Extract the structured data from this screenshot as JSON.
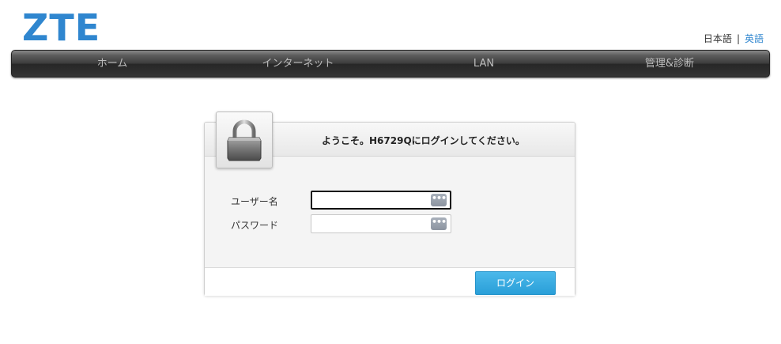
{
  "brand": {
    "logo_text": "ZTE",
    "accent_color": "#2f86cf"
  },
  "language": {
    "current": "日本語",
    "separator": "|",
    "other": "英語"
  },
  "nav": {
    "items": [
      {
        "label": "ホーム"
      },
      {
        "label": "インターネット"
      },
      {
        "label": "LAN"
      },
      {
        "label": "管理&診断"
      }
    ]
  },
  "login": {
    "icon": "padlock-icon",
    "title": "ようこそ。H6729Qにログインしてください。",
    "username_label": "ユーザー名",
    "username_value": "",
    "password_label": "パスワード",
    "password_value": "",
    "password_manager_icon": "dots-icon",
    "password_manager_glyph": "•••",
    "submit_label": "ログイン",
    "button_color": "#2a9fd8"
  }
}
